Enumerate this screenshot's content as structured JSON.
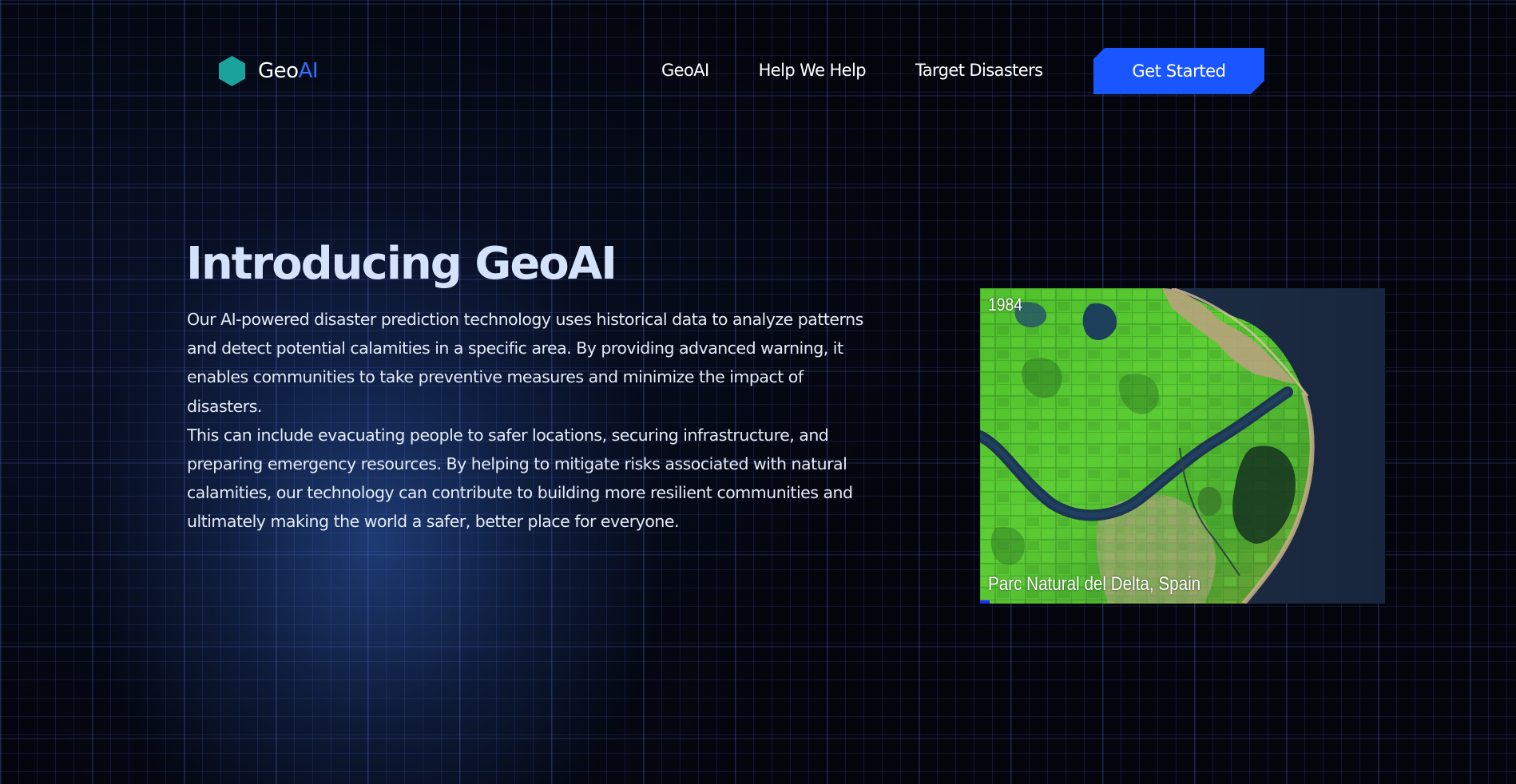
{
  "brand": {
    "name_part1": "Geo",
    "name_part2": "AI",
    "logo_icon": "hexagon-icon",
    "logo_color": "#1aa39c",
    "accent_color": "#2e73ff"
  },
  "nav": {
    "items": [
      {
        "label": "GeoAI"
      },
      {
        "label": "Help We Help"
      },
      {
        "label": "Target Disasters"
      }
    ],
    "cta_label": "Get Started",
    "cta_color": "#1a56ff"
  },
  "hero": {
    "title": "Introducing GeoAI",
    "paragraph_1": "Our AI-powered disaster prediction technology uses historical data to analyze patterns and detect potential calamities in a specific area. By providing advanced warning, it enables communities to take preventive measures and minimize the impact of disasters.",
    "paragraph_2": "This can include evacuating people to safer locations, securing infrastructure, and preparing emergency resources. By helping to mitigate risks associated with natural calamities, our technology can contribute to building more resilient communities and ultimately making the world a safer, better place for everyone."
  },
  "satellite": {
    "year": "1984",
    "caption": "Parc Natural del Delta, Spain"
  }
}
